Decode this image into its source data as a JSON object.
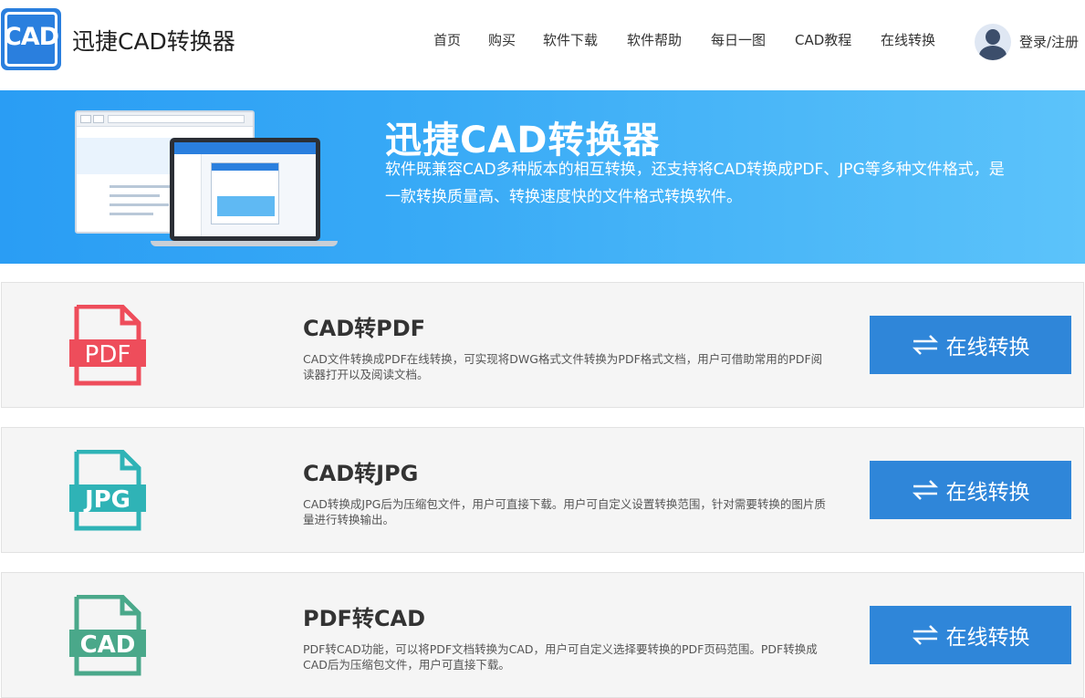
{
  "header": {
    "logo_text": "CAD",
    "brand": "迅捷CAD转换器",
    "nav": [
      {
        "label": "首页"
      },
      {
        "label": "购买"
      },
      {
        "label": "软件下载"
      },
      {
        "label": "软件帮助"
      },
      {
        "label": "每日一图"
      },
      {
        "label": "CAD教程"
      },
      {
        "label": "在线转换"
      }
    ],
    "login": "登录/注册"
  },
  "banner": {
    "title": "迅捷CAD转换器",
    "desc": "软件既兼容CAD多种版本的相互转换，还支持将CAD转换成PDF、JPG等多种文件格式，是一款转换质量高、转换速度快的文件格式转换软件。"
  },
  "cards": [
    {
      "icon_label": "PDF",
      "icon_color": "#ee4d5b",
      "title": "CAD转PDF",
      "desc": "CAD文件转换成PDF在线转换，可实现将DWG格式文件转换为PDF格式文档，用户可借助常用的PDF阅读器打开以及阅读文档。",
      "button": "在线转换"
    },
    {
      "icon_label": "JPG",
      "icon_color": "#2fb3b6",
      "title": "CAD转JPG",
      "desc": "CAD转换成JPG后为压缩包文件，用户可直接下载。用户可自定义设置转换范围，针对需要转换的图片质量进行转换输出。",
      "button": "在线转换"
    },
    {
      "icon_label": "CAD",
      "icon_color": "#4aa88a",
      "title": "PDF转CAD",
      "desc": "PDF转CAD功能，可以将PDF文档转换为CAD，用户可自定义选择要转换的PDF页码范围。PDF转换成CAD后为压缩包文件，用户可直接下载。",
      "button": "在线转换"
    }
  ],
  "colors": {
    "accent": "#2f86d9",
    "banner_start": "#2a9df4",
    "banner_end": "#5cc3fa",
    "card_bg": "#f5f5f5"
  }
}
